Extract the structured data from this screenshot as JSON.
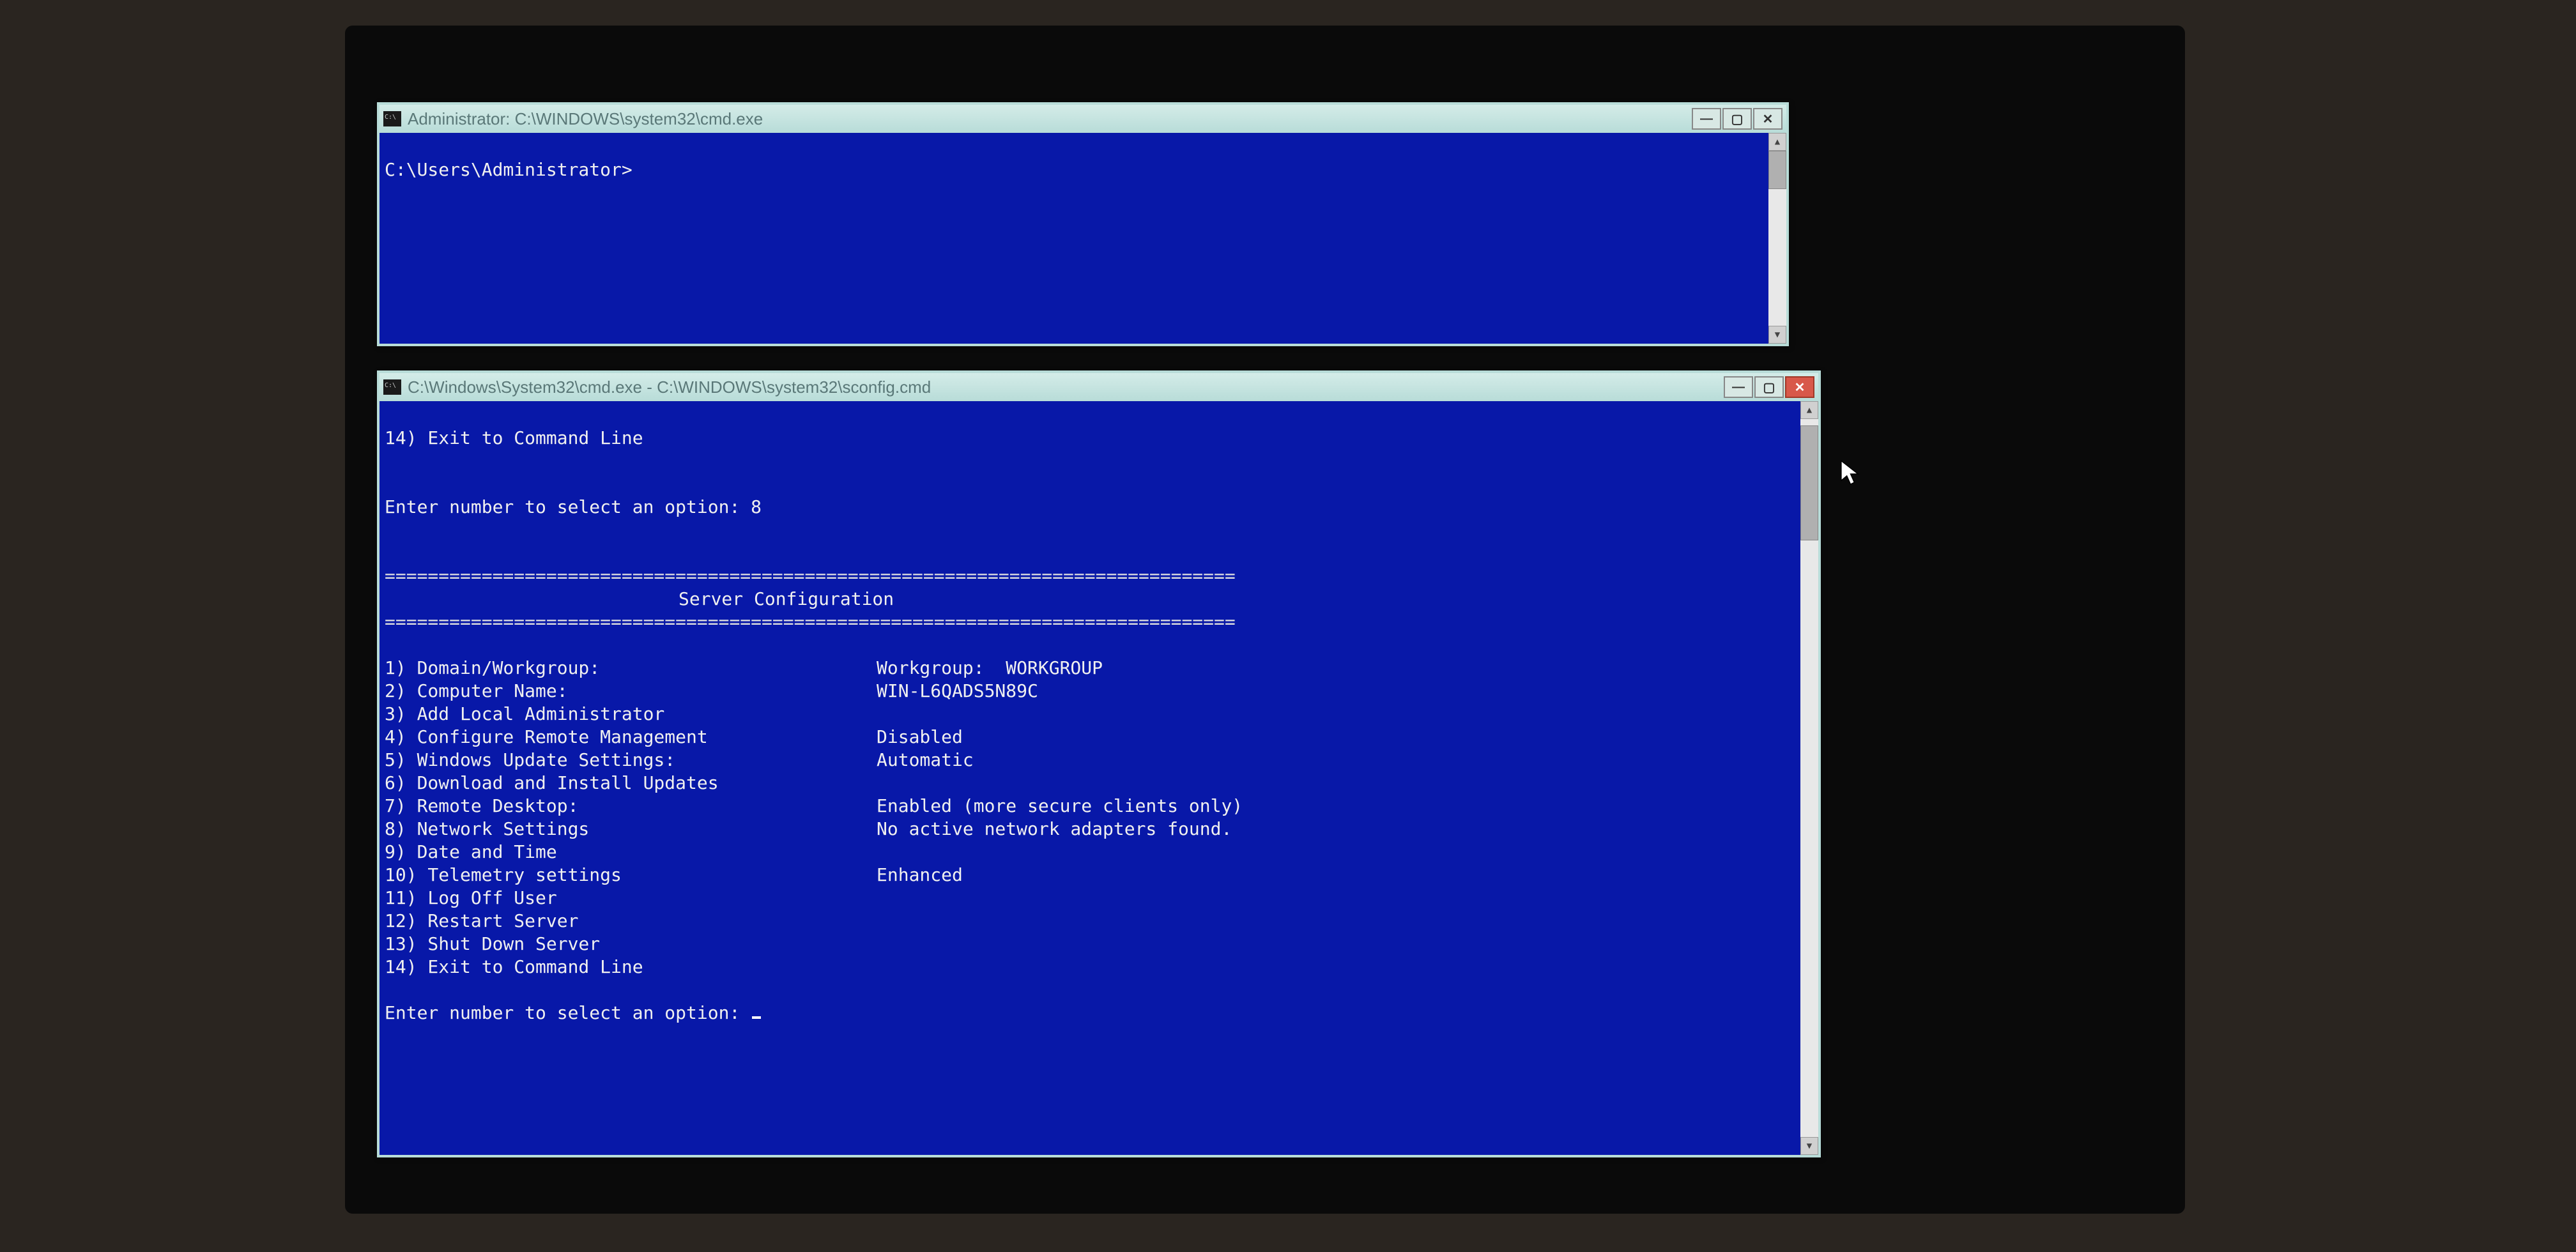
{
  "window1": {
    "title": "Administrator: C:\\WINDOWS\\system32\\cmd.exe",
    "prompt": "C:\\Users\\Administrator>"
  },
  "window2": {
    "title": "C:\\Windows\\System32\\cmd.exe - C:\\WINDOWS\\system32\\sconfig.cmd",
    "prev_menu_tail": "14) Exit to Command Line",
    "prev_prompt": "Enter number to select an option: 8",
    "divider": "===============================================================================",
    "header": "Server Configuration",
    "menu": [
      {
        "label": "1) Domain/Workgroup:",
        "value": "Workgroup:  WORKGROUP"
      },
      {
        "label": "2) Computer Name:",
        "value": "WIN-L6QADS5N89C"
      },
      {
        "label": "3) Add Local Administrator",
        "value": ""
      },
      {
        "label": "4) Configure Remote Management",
        "value": "Disabled"
      },
      {
        "label": "",
        "value": ""
      },
      {
        "label": "5) Windows Update Settings:",
        "value": "Automatic"
      },
      {
        "label": "6) Download and Install Updates",
        "value": ""
      },
      {
        "label": "7) Remote Desktop:",
        "value": "Enabled (more secure clients only)"
      },
      {
        "label": "",
        "value": ""
      },
      {
        "label": "8) Network Settings",
        "value": "No active network adapters found."
      },
      {
        "label": "9) Date and Time",
        "value": ""
      },
      {
        "label": "10) Telemetry settings",
        "value": "Enhanced"
      },
      {
        "label": "",
        "value": ""
      },
      {
        "label": "11) Log Off User",
        "value": ""
      },
      {
        "label": "12) Restart Server",
        "value": ""
      },
      {
        "label": "13) Shut Down Server",
        "value": ""
      },
      {
        "label": "14) Exit to Command Line",
        "value": ""
      }
    ],
    "prompt": "Enter number to select an option: "
  },
  "controls": {
    "minimize_glyph": "—",
    "maximize_glyph": "▢",
    "close_glyph": "✕",
    "arrow_up": "▲",
    "arrow_down": "▼"
  }
}
